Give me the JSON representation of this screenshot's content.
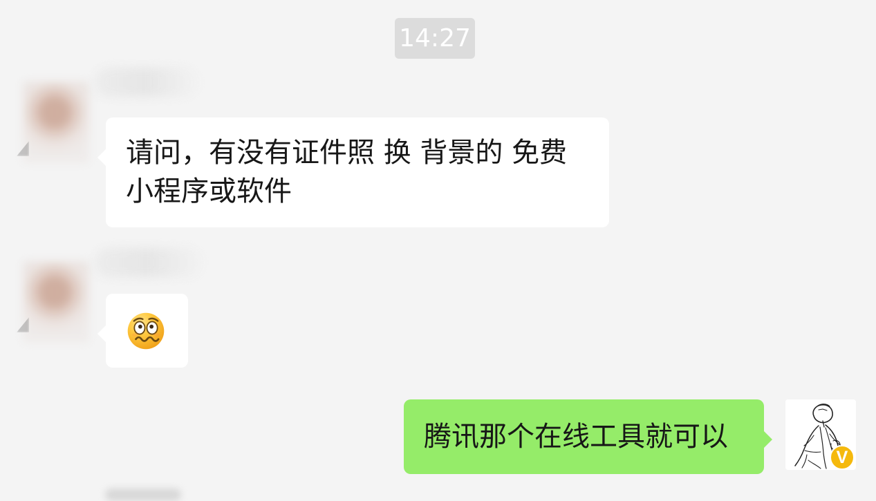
{
  "timestamp": "14:27",
  "messages": [
    {
      "sender": "other",
      "text": "请问，有没有证件照 换 背景的 免费小程序或软件"
    },
    {
      "sender": "other",
      "emoji": "woozy-face-emoji"
    },
    {
      "sender": "self",
      "text": "腾讯那个在线工具就可以"
    }
  ],
  "badge": {
    "text": "V"
  },
  "colors": {
    "background": "#f4f4f4",
    "incoming_bubble": "#ffffff",
    "outgoing_bubble": "#95ec69",
    "badge": "#f5b90d",
    "timestamp_bg": "#dcdcdc"
  },
  "icons": {
    "emoji": "woozy-face-emoji",
    "avatar": "sketch-avatar",
    "badge": "v-badge-icon"
  }
}
